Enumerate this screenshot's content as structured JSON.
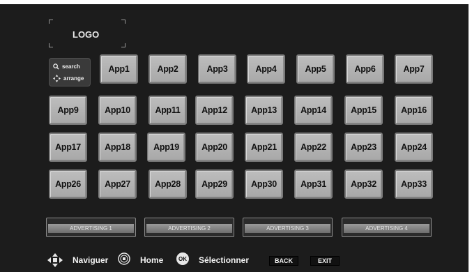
{
  "logo": {
    "text": "LOGO"
  },
  "side_panel": {
    "search_label": "search",
    "arrange_label": "arrange"
  },
  "apps": [
    "App1",
    "App2",
    "App3",
    "App4",
    "App5",
    "App6",
    "App7",
    "App9",
    "App10",
    "App11",
    "App12",
    "App13",
    "App14",
    "App15",
    "App16",
    "App17",
    "App18",
    "App19",
    "App20",
    "App21",
    "App22",
    "App23",
    "App24",
    "App26",
    "App27",
    "App28",
    "App29",
    "App30",
    "App31",
    "App32",
    "App33"
  ],
  "ads": [
    "ADVERTISING 1",
    "ADVERTISING 2",
    "ADVERTISING 3",
    "ADVERTISING 4"
  ],
  "nav": {
    "navigate_label": "Naviguer",
    "home_label": "Home",
    "select_label": "Sélectionner",
    "ok_badge": "OK",
    "back_key": "BACK",
    "exit_key": "EXIT"
  }
}
